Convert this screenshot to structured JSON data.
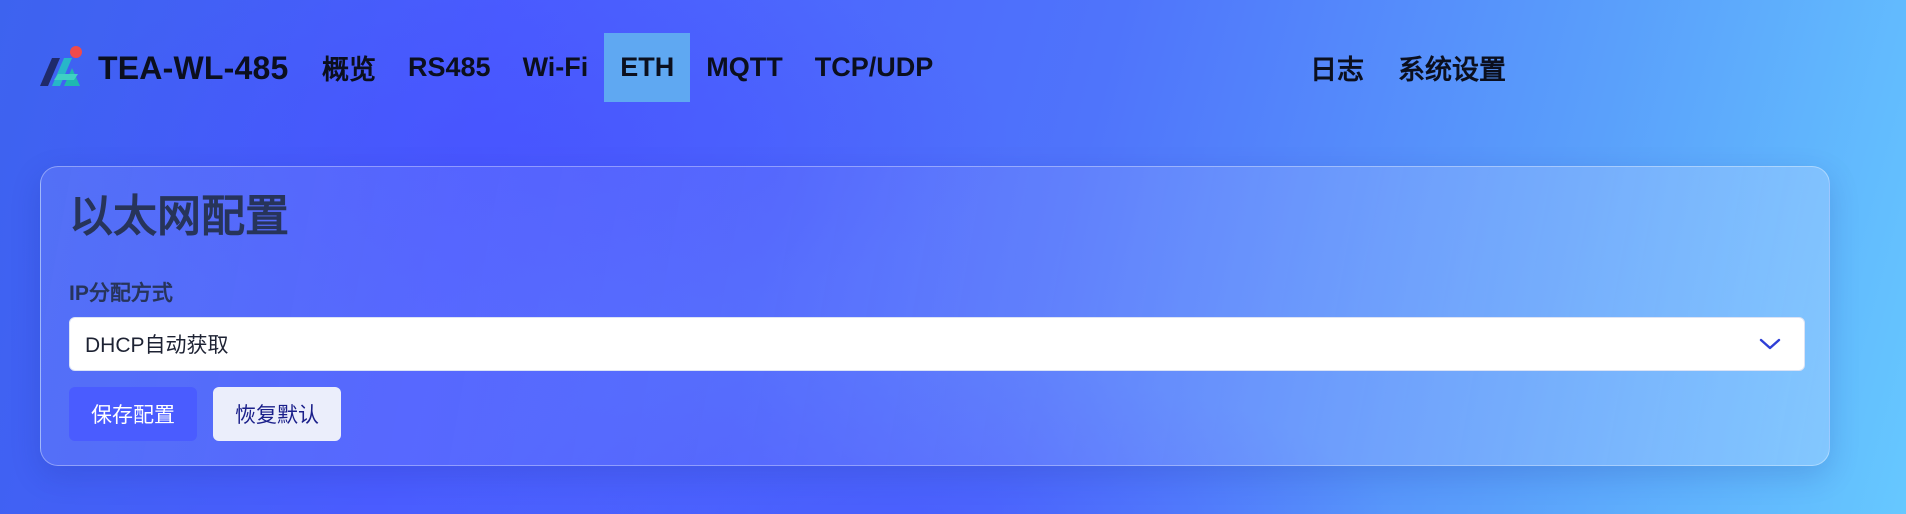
{
  "brand": {
    "name": "TEA-WL-485",
    "logo_icon": "brand-logo-icon"
  },
  "nav": {
    "items": [
      {
        "label": "概览"
      },
      {
        "label": "RS485"
      },
      {
        "label": "Wi-Fi"
      },
      {
        "label": "ETH"
      },
      {
        "label": "MQTT"
      },
      {
        "label": "TCP/UDP"
      }
    ],
    "active": "ETH",
    "right_items": [
      {
        "label": "日志"
      },
      {
        "label": "系统设置"
      }
    ]
  },
  "card": {
    "title": "以太网配置",
    "ip_mode": {
      "label": "IP分配方式",
      "value": "DHCP自动获取",
      "icon": "chevron-down-icon"
    },
    "buttons": {
      "save": "保存配置",
      "reset": "恢复默认"
    }
  },
  "colors": {
    "accent": "#4a5cff",
    "active_tab": "#5fa8f2",
    "text_dark": "#27345a"
  }
}
